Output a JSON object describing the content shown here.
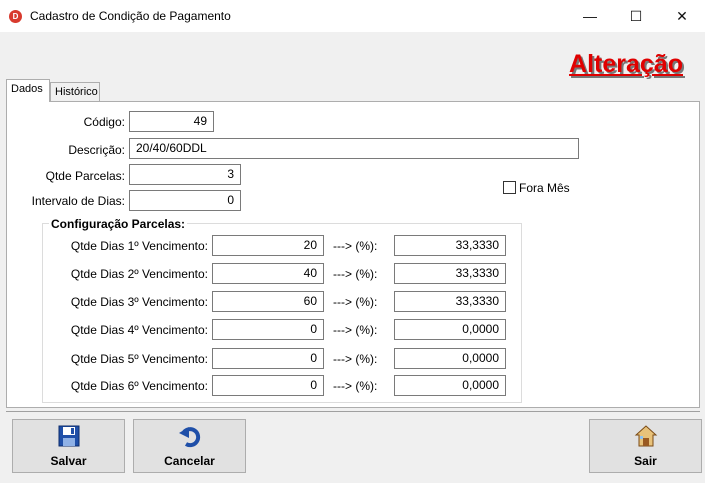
{
  "window": {
    "title": "Cadastro de Condição de Pagamento",
    "icon_letter": "D",
    "minimize": "—",
    "maximize": "☐",
    "close": "✕"
  },
  "mode_title": "Alteração",
  "tabs": [
    {
      "label": "Dados",
      "active": true
    },
    {
      "label": "Histórico",
      "active": false
    }
  ],
  "form": {
    "codigo_label": "Código:",
    "codigo_value": "49",
    "descricao_label": "Descrição:",
    "descricao_value": "20/40/60DDL",
    "qtde_parcelas_label": "Qtde Parcelas:",
    "qtde_parcelas_value": "3",
    "intervalo_label": "Intervalo de Dias:",
    "intervalo_value": "0",
    "fora_mes_label": "Fora Mês",
    "fora_mes_checked": false
  },
  "config": {
    "title": "Configuração Parcelas:",
    "arrow_text": "---> (%):",
    "rows": [
      {
        "label": "Qtde Dias 1º Vencimento:",
        "dias": "20",
        "percent": "33,3330"
      },
      {
        "label": "Qtde Dias 2º Vencimento:",
        "dias": "40",
        "percent": "33,3330"
      },
      {
        "label": "Qtde Dias 3º Vencimento:",
        "dias": "60",
        "percent": "33,3330"
      },
      {
        "label": "Qtde Dias 4º Vencimento:",
        "dias": "0",
        "percent": "0,0000"
      },
      {
        "label": "Qtde Dias 5º Vencimento:",
        "dias": "0",
        "percent": "0,0000"
      },
      {
        "label": "Qtde Dias 6º Vencimento:",
        "dias": "0",
        "percent": "0,0000"
      }
    ]
  },
  "buttons": {
    "salvar": "Salvar",
    "cancelar": "Cancelar",
    "sair": "Sair"
  },
  "colors": {
    "mode_title": "#e00000",
    "background": "#f0f0f0",
    "panel": "#ffffff"
  }
}
